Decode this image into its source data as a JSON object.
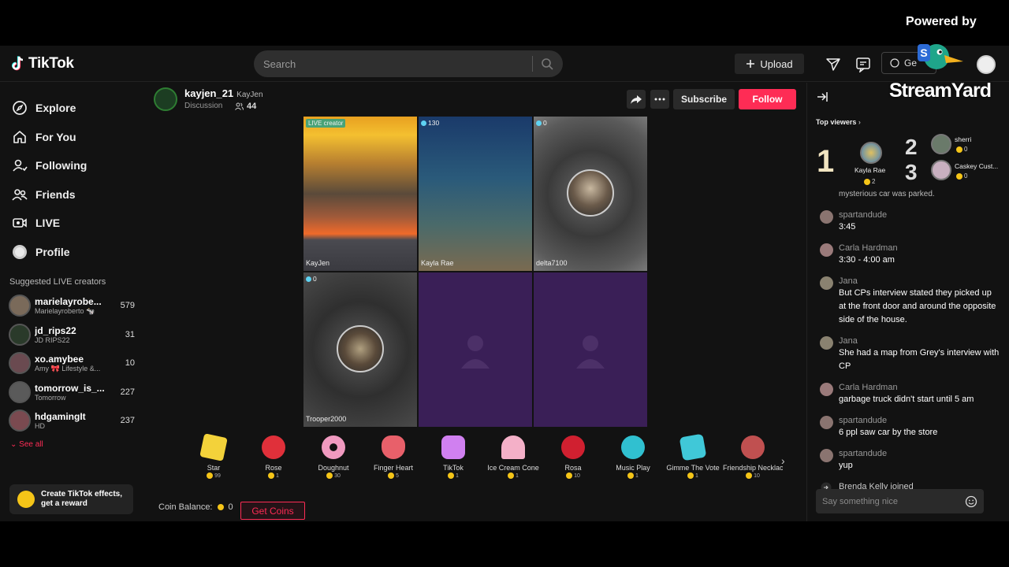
{
  "header": {
    "brand": "TikTok",
    "search_placeholder": "Search",
    "upload_label": "Upload",
    "get_label": "Ge"
  },
  "overlay": {
    "powered_by": "Powered by",
    "brand": "StreamYard"
  },
  "sidebar": {
    "nav": [
      {
        "label": "Explore",
        "icon": "compass-icon"
      },
      {
        "label": "For You",
        "icon": "home-icon"
      },
      {
        "label": "Following",
        "icon": "following-icon"
      },
      {
        "label": "Friends",
        "icon": "friends-icon"
      },
      {
        "label": "LIVE",
        "icon": "live-icon"
      },
      {
        "label": "Profile",
        "icon": "profile-icon"
      }
    ],
    "suggested_title": "Suggested LIVE creators",
    "creators": [
      {
        "name": "marielayrobe...",
        "sub": "Marielayroberto 🐄",
        "count": "579",
        "color": "#7a6a5a"
      },
      {
        "name": "jd_rips22",
        "sub": "JD RIPS22",
        "count": "31",
        "color": "#2a3a2a"
      },
      {
        "name": "xo.amybee",
        "sub": "Amy 🎀 Lifestyle &...",
        "count": "10",
        "color": "#6a4a50"
      },
      {
        "name": "tomorrow_is_...",
        "sub": "Tomorrow",
        "count": "227",
        "color": "#5a5a5a"
      },
      {
        "name": "hdgamingIt",
        "sub": "HD",
        "count": "237",
        "color": "#7a4a50"
      }
    ],
    "see_all": "See all",
    "effects_line1": "Create TikTok effects,",
    "effects_line2": "get a reward"
  },
  "stream": {
    "host_name": "kayjen_21",
    "host_nick": "KayJen",
    "topic": "Discussion",
    "viewers": "44",
    "subscribe_label": "Subscribe",
    "follow_label": "Follow",
    "tiles": [
      {
        "label": "KayJen",
        "badge": "LIVE creator"
      },
      {
        "label": "Kayla Rae",
        "badge": "130"
      },
      {
        "label": "delta7100",
        "badge": "0"
      },
      {
        "label": "Trooper2000",
        "badge": "0"
      }
    ]
  },
  "gifts": [
    {
      "name": "Star",
      "price": "99",
      "color": "#f3d23a"
    },
    {
      "name": "Rose",
      "price": "1",
      "color": "#e0303a"
    },
    {
      "name": "Doughnut",
      "price": "30",
      "color": "#f09ac0"
    },
    {
      "name": "Finger Heart",
      "price": "5",
      "color": "#e8606a"
    },
    {
      "name": "TikTok",
      "price": "1",
      "color": "#d080f0"
    },
    {
      "name": "Ice Cream Cone",
      "price": "1",
      "color": "#f4b0c8"
    },
    {
      "name": "Rosa",
      "price": "10",
      "color": "#d02030"
    },
    {
      "name": "Music Play",
      "price": "1",
      "color": "#30c0d0"
    },
    {
      "name": "Gimme The Vote",
      "price": "1",
      "color": "#40c8d8"
    },
    {
      "name": "Friendship Necklac",
      "price": "10",
      "color": "#c05050"
    }
  ],
  "coins": {
    "balance_label": "Coin Balance:",
    "balance": "0",
    "get_coins": "Get Coins"
  },
  "panel": {
    "top_viewers_title": "Top viewers",
    "top_viewers": [
      {
        "rank": "1",
        "name": "Kayla Rae",
        "coins": "2"
      },
      {
        "rank": "2",
        "name": "sherri",
        "coins": "0"
      },
      {
        "rank": "3",
        "name": "Caskey Cust...",
        "coins": "0"
      }
    ],
    "chat_cut": "mysterious car was parked.",
    "messages": [
      {
        "user": "spartandude",
        "text": "3:45"
      },
      {
        "user": "Carla Hardman",
        "text": "3:30 - 4:00 am"
      },
      {
        "user": "Jana",
        "text": "But CPs interview stated they picked up at the front door and around the opposite side of the house."
      },
      {
        "user": "Jana",
        "text": "She had a map from Grey's interview with CP"
      },
      {
        "user": "Carla Hardman",
        "text": "garbage truck didn't start until 5 am"
      },
      {
        "user": "spartandude",
        "text": "6 ppl saw car by the store"
      },
      {
        "user": "spartandude",
        "text": "yup"
      }
    ],
    "joined": "Brenda Kelly joined",
    "chat_placeholder": "Say something nice"
  },
  "colors": {
    "accent": "#fe2c55",
    "coin": "#f5c518",
    "placeholder_tile": "#3a1f57"
  }
}
